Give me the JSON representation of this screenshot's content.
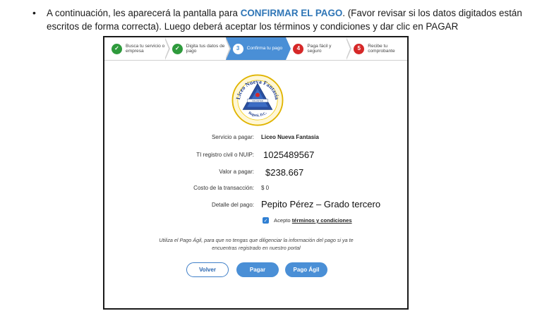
{
  "document": {
    "bullet": "•",
    "text_before": "A continuación, les aparecerá la pantalla para ",
    "highlight": "CONFIRMAR EL PAGO",
    "text_after": ". (Favor revisar si los datos digitados están escritos de forma correcta). Luego deberá aceptar los términos y condiciones y dar clic en PAGAR",
    "accent_color": "#2e75b6"
  },
  "steps": [
    {
      "number": "✓",
      "label": "Busca tu servicio o empresa",
      "state": "done"
    },
    {
      "number": "✓",
      "label": "Digita tus datos de pago",
      "state": "done"
    },
    {
      "number": "3",
      "label": "Confirma tu pago",
      "state": "active"
    },
    {
      "number": "4",
      "label": "Paga fácil y seguro",
      "state": "todo"
    },
    {
      "number": "5",
      "label": "Recibe tu comprobante",
      "state": "todo"
    }
  ],
  "logo": {
    "top_text": "Liceo Nueva Fantasía",
    "bottom_text": "Bogotá, D.C.",
    "band_text": "VOLUNTAD"
  },
  "form": {
    "service_label": "Servicio a pagar:",
    "service_value": "Liceo Nueva Fantasia",
    "nuip_label": "TI registro civil o NUIP:",
    "nuip_value": "1025489567",
    "amount_label": "Valor a pagar:",
    "amount_value": "$238.667",
    "cost_label": "Costo de la transacción:",
    "cost_value": "$ 0",
    "detail_label": "Detalle del pago:",
    "detail_value": "Pepito Pérez – Grado tercero"
  },
  "terms": {
    "checked": true,
    "prefix": "Acepto ",
    "link": "términos y condiciones"
  },
  "note": "Utiliza el Pago Ágil, para que no tengas que diligenciar la información del pago si ya te encuentras registrado en nuestro portal",
  "buttons": {
    "back": "Volver",
    "pay": "Pagar",
    "agil": "Pago Ágil"
  },
  "colors": {
    "primary": "#4a8fd6",
    "done": "#2e9a3c",
    "todo": "#d62828"
  }
}
